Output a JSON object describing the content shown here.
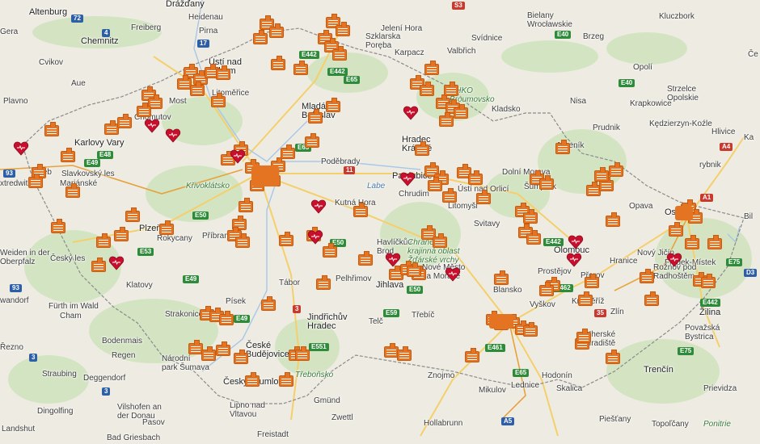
{
  "map": {
    "colors": {
      "land": "#eeece2",
      "forest": "#cfe3bd",
      "border": "#7a7a7a",
      "hospital_marker": "#e47422",
      "heart_marker": "#c8102e"
    },
    "labels": [
      {
        "id": "altenburg",
        "text": "Altenburg"
      },
      {
        "id": "drazdany",
        "text": "Drážďany"
      },
      {
        "id": "heidenau",
        "text": "Heidenau"
      },
      {
        "id": "pirna",
        "text": "Pirna"
      },
      {
        "id": "freiberg",
        "text": "Freiberg"
      },
      {
        "id": "chemnitz",
        "text": "Chemnitz"
      },
      {
        "id": "cvikov",
        "text": "Cvikov"
      },
      {
        "id": "aue",
        "text": "Aue"
      },
      {
        "id": "plavno",
        "text": "Plavno"
      },
      {
        "id": "usti",
        "text": "Ústí nad\nLabem"
      },
      {
        "id": "litomerice",
        "text": "Litoměřice"
      },
      {
        "id": "most",
        "text": "Most"
      },
      {
        "id": "chomutov",
        "text": "Chomutov"
      },
      {
        "id": "karlovy",
        "text": "Karlovy Vary"
      },
      {
        "id": "slavkovsky",
        "text": "Slavkovský les"
      },
      {
        "id": "marianske",
        "text": "Mariánské"
      },
      {
        "id": "krivoklatsko",
        "text": "Křivoklátsko"
      },
      {
        "id": "pizen",
        "text": "Plzeň"
      },
      {
        "id": "rokycany",
        "text": "Rokycany"
      },
      {
        "id": "pribram",
        "text": "Příbram"
      },
      {
        "id": "ceskyles",
        "text": "Český les"
      },
      {
        "id": "weiden",
        "text": "Weiden in der\nOberpfalz"
      },
      {
        "id": "klatovy",
        "text": "Klatovy"
      },
      {
        "id": "furth",
        "text": "Fürth im Wald"
      },
      {
        "id": "cham",
        "text": "Cham"
      },
      {
        "id": "strakonice",
        "text": "Strakonice"
      },
      {
        "id": "pisek",
        "text": "Písek"
      },
      {
        "id": "tabor",
        "text": "Tábor"
      },
      {
        "id": "bodenmais",
        "text": "Bodenmais"
      },
      {
        "id": "regen",
        "text": "Regen"
      },
      {
        "id": "narodni",
        "text": "Národní\npark Šumava"
      },
      {
        "id": "straubing",
        "text": "Straubing"
      },
      {
        "id": "deggendorf",
        "text": "Deggendorf"
      },
      {
        "id": "dingolfing",
        "text": "Dingolfing"
      },
      {
        "id": "vilshofen",
        "text": "Vilshofen an\nder Donau"
      },
      {
        "id": "pasov",
        "text": "Pasov"
      },
      {
        "id": "landshut",
        "text": "Landshut"
      },
      {
        "id": "badgries",
        "text": "Bad Griesbach"
      },
      {
        "id": "freistadt",
        "text": "Freistadt"
      },
      {
        "id": "ceskykrumlov",
        "text": "Český Krumlov"
      },
      {
        "id": "ceskebud",
        "text": "České\nBudějovice"
      },
      {
        "id": "trebonsko",
        "text": "Třeboňsko"
      },
      {
        "id": "lipno",
        "text": "Lipno nad\nVltavou"
      },
      {
        "id": "gmund",
        "text": "Gmünd"
      },
      {
        "id": "zwettl",
        "text": "Zwettl"
      },
      {
        "id": "hollabrunn",
        "text": "Hollabrunn"
      },
      {
        "id": "jindrichuv",
        "text": "Jindřichův\nHradec"
      },
      {
        "id": "pelhrimov",
        "text": "Pelhřimov"
      },
      {
        "id": "jihlava",
        "text": "Jihlava"
      },
      {
        "id": "havlickuv",
        "text": "Havlíčkův\nBrod"
      },
      {
        "id": "kutna",
        "text": "Kutná Hora"
      },
      {
        "id": "podebrady",
        "text": "Poděbrady"
      },
      {
        "id": "labe",
        "text": "Labe"
      },
      {
        "id": "mlada",
        "text": "Mladá\nBoleslav"
      },
      {
        "id": "jeleni",
        "text": "Jelení Hora"
      },
      {
        "id": "szklarska",
        "text": "Szklarska\nPoręba"
      },
      {
        "id": "karpacz",
        "text": "Karpacz"
      },
      {
        "id": "svidnice",
        "text": "Svídnice"
      },
      {
        "id": "valbrich",
        "text": "Valbřich"
      },
      {
        "id": "chko",
        "text": "CHKO\nBroumovsko"
      },
      {
        "id": "klodzko",
        "text": "Kladsko"
      },
      {
        "id": "hradec",
        "text": "Hradec\nKrálové"
      },
      {
        "id": "pardubice",
        "text": "Pardubice"
      },
      {
        "id": "chrudim",
        "text": "Chrudim"
      },
      {
        "id": "usti_orlici",
        "text": "Ústí nad Orlicí"
      },
      {
        "id": "litomysl",
        "text": "Litomyšl"
      },
      {
        "id": "svitavy",
        "text": "Svitavy"
      },
      {
        "id": "zdarske",
        "text": "Chráněná\nkrajinná oblast\nŽďárské vrchy"
      },
      {
        "id": "nmnm",
        "text": "Nové Město\nna Moravě"
      },
      {
        "id": "trebic",
        "text": "Třebíč"
      },
      {
        "id": "telc",
        "text": "Telč"
      },
      {
        "id": "znojmo",
        "text": "Znojmo"
      },
      {
        "id": "mikulov",
        "text": "Mikulov"
      },
      {
        "id": "lednice",
        "text": "Lednice"
      },
      {
        "id": "blansko",
        "text": "Blansko"
      },
      {
        "id": "vyskov",
        "text": "Vyškov"
      },
      {
        "id": "prostejov",
        "text": "Prostějov"
      },
      {
        "id": "prerov",
        "text": "Přerov"
      },
      {
        "id": "kromeriz",
        "text": "Kroměříž"
      },
      {
        "id": "zlin",
        "text": "Zlín"
      },
      {
        "id": "uherske",
        "text": "Uherské\nHradiště"
      },
      {
        "id": "hodonin",
        "text": "Hodonín"
      },
      {
        "id": "skalica",
        "text": "Skalica"
      },
      {
        "id": "olomouc",
        "text": "Olomouc"
      },
      {
        "id": "sumperk",
        "text": "Šumperk"
      },
      {
        "id": "dolni",
        "text": "Dolní Morava"
      },
      {
        "id": "jesenik",
        "text": "Jeseník"
      },
      {
        "id": "krnov",
        "text": "Krnov"
      },
      {
        "id": "opava",
        "text": "Opava"
      },
      {
        "id": "ostrava",
        "text": "Ostrava"
      },
      {
        "id": "frydek",
        "text": "Frýdek-Místek"
      },
      {
        "id": "novy",
        "text": "Nový Jičín"
      },
      {
        "id": "roznov",
        "text": "Rožnov pod\nRadhoštěm"
      },
      {
        "id": "hranice",
        "text": "Hranice"
      },
      {
        "id": "zilina",
        "text": "Žilina"
      },
      {
        "id": "povazska",
        "text": "Považská\nBystrica"
      },
      {
        "id": "trencin",
        "text": "Trenčín"
      },
      {
        "id": "prievidza",
        "text": "Prievidza"
      },
      {
        "id": "piestany",
        "text": "Piešťany"
      },
      {
        "id": "topolcany",
        "text": "Topoľčany"
      },
      {
        "id": "ponitrie",
        "text": "Ponitrie"
      },
      {
        "id": "nysa",
        "text": "Nisa"
      },
      {
        "id": "prudnik",
        "text": "Prudnik"
      },
      {
        "id": "krapkowice",
        "text": "Krapkowice"
      },
      {
        "id": "kedzierzyn",
        "text": "Kędzierzyn-Koźle"
      },
      {
        "id": "strzelce",
        "text": "Strzelce\nOpolskie"
      },
      {
        "id": "opole",
        "text": "Opolí"
      },
      {
        "id": "brzeg",
        "text": "Brzeg"
      },
      {
        "id": "kluczbork",
        "text": "Kluczbork"
      },
      {
        "id": "bielany",
        "text": "Bielany\nWrocławskie"
      },
      {
        "id": "hlivice",
        "text": "Hlivice"
      },
      {
        "id": "rybnik",
        "text": "rybnik"
      },
      {
        "id": "gera",
        "text": "Gera"
      },
      {
        "id": "landshut2",
        "text": "Landshut"
      },
      {
        "id": "rezno",
        "text": "Řezno"
      },
      {
        "id": "wandorf",
        "text": "wandorf"
      },
      {
        "id": "extredwitz",
        "text": "xtredwitz"
      },
      {
        "id": "ka",
        "text": "Ka"
      },
      {
        "id": "ce",
        "text": "Če"
      },
      {
        "id": "bil",
        "text": "Bil"
      },
      {
        "id": "cheb",
        "text": "Cheb"
      }
    ],
    "shields": [
      {
        "id": "s72",
        "text": "72"
      },
      {
        "id": "s4",
        "text": "4"
      },
      {
        "id": "s17",
        "text": "17"
      },
      {
        "id": "se442",
        "text": "E442"
      },
      {
        "id": "se442b",
        "text": "E442"
      },
      {
        "id": "se65",
        "text": "E65"
      },
      {
        "id": "se48",
        "text": "E48"
      },
      {
        "id": "se49",
        "text": "E49"
      },
      {
        "id": "se50",
        "text": "E50"
      },
      {
        "id": "se53",
        "text": "E53"
      },
      {
        "id": "s93",
        "text": "93"
      },
      {
        "id": "s93b",
        "text": "93"
      },
      {
        "id": "se49b",
        "text": "E49"
      },
      {
        "id": "s3",
        "text": "3"
      },
      {
        "id": "s3b",
        "text": "3"
      },
      {
        "id": "se49c",
        "text": "E49"
      },
      {
        "id": "se551",
        "text": "E551"
      },
      {
        "id": "se59",
        "text": "E59"
      },
      {
        "id": "se50b",
        "text": "E50"
      },
      {
        "id": "se461",
        "text": "E461"
      },
      {
        "id": "se65b",
        "text": "E65"
      },
      {
        "id": "sa5",
        "text": "A5"
      },
      {
        "id": "se442c",
        "text": "E442"
      },
      {
        "id": "se462",
        "text": "E462"
      },
      {
        "id": "se75",
        "text": "E75"
      },
      {
        "id": "se75b",
        "text": "E75"
      },
      {
        "id": "se40",
        "text": "E40"
      },
      {
        "id": "se40b",
        "text": "E40"
      },
      {
        "id": "sa4",
        "text": "A4"
      },
      {
        "id": "sa1",
        "text": "A1"
      },
      {
        "id": "sd3",
        "text": "D3"
      },
      {
        "id": "s11",
        "text": "11"
      },
      {
        "id": "se65c",
        "text": "E65"
      },
      {
        "id": "se50c",
        "text": "E50"
      },
      {
        "id": "se442d",
        "text": "E442"
      },
      {
        "id": "s35",
        "text": "35"
      },
      {
        "id": "s3c",
        "text": "3"
      },
      {
        "id": "s5",
        "text": "S3"
      }
    ]
  }
}
